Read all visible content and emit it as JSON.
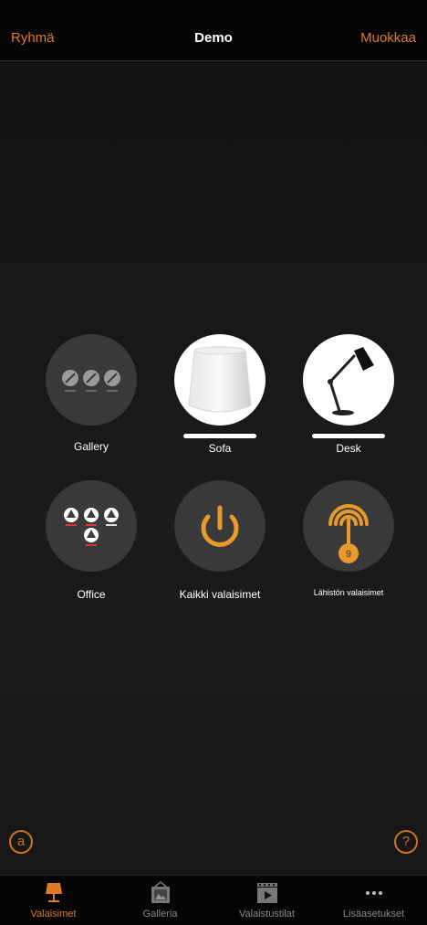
{
  "header": {
    "left_label": "Ryhmä",
    "title": "Demo",
    "right_label": "Muokkaa"
  },
  "tiles": [
    {
      "label": "Gallery"
    },
    {
      "label": "Sofa"
    },
    {
      "label": "Desk"
    },
    {
      "label": "Office"
    },
    {
      "label": "Kaikki valaisimet"
    },
    {
      "label": "Lähistön valaisimet",
      "badge": "9"
    }
  ],
  "tabs": [
    {
      "label": "Valaisimet",
      "icon": "lamp-icon",
      "active": true
    },
    {
      "label": "Galleria",
      "icon": "gallery-icon",
      "active": false
    },
    {
      "label": "Valaistustilat",
      "icon": "scene-icon",
      "active": false
    },
    {
      "label": "Lisäasetukset",
      "icon": "more-icon",
      "active": false
    }
  ],
  "colors": {
    "accent": "#e07b25",
    "background": "#151515",
    "tile": "#3a3a3a"
  }
}
